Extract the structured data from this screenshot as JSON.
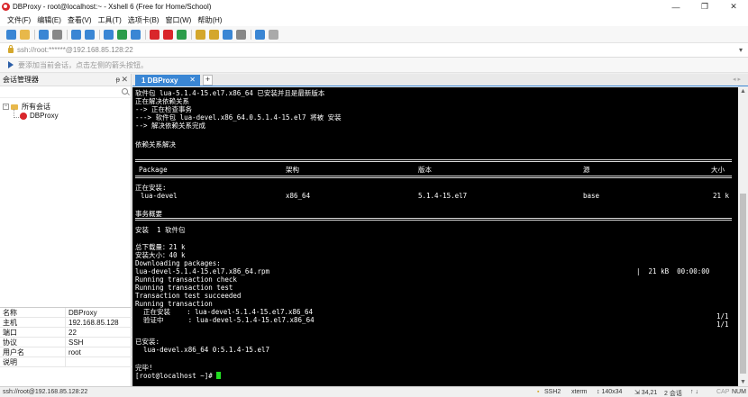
{
  "window": {
    "title": "DBProxy - root@localhost:~ - Xshell 6 (Free for Home/School)",
    "controls": [
      "—",
      "❐",
      "✕"
    ]
  },
  "menu": [
    "文件(F)",
    "编辑(E)",
    "查看(V)",
    "工具(T)",
    "选项卡(B)",
    "窗口(W)",
    "帮助(H)"
  ],
  "toolbar": {
    "icons": [
      "new-session-icon",
      "open-folder-icon",
      "reconnect-icon",
      "disconnect-icon",
      "properties-icon",
      "find-icon",
      "layout-icon",
      "globe-icon",
      "color-scheme-icon",
      "xshell-icon",
      "xftp-icon",
      "fullscreen-icon",
      "lock-icon",
      "keyboard-icon",
      "script-icon",
      "compose-icon",
      "help-icon",
      "chat-icon"
    ],
    "icon_colors": [
      "#3a86d4",
      "#e8b84a",
      "#3a86d4",
      "#888888",
      "#3a86d4",
      "#3a86d4",
      "#3a86d4",
      "#2b9c4a",
      "#3a86d4",
      "#d9262b",
      "#d9262b",
      "#2b9c4a",
      "#d4a72c",
      "#d4a72c",
      "#3a86d4",
      "#888888",
      "#3a86d4",
      "#aaaaaa"
    ]
  },
  "address": {
    "text": "ssh://root:******@192.168.85.128:22"
  },
  "hint": {
    "text": "要添加当前会话，点击左侧的箭头按钮。"
  },
  "sidebar": {
    "title": "会话管理器",
    "pin": "ᵽ",
    "close": "✕",
    "tree": {
      "root_label": "所有会话",
      "child_label": "DBProxy"
    },
    "properties": [
      {
        "key": "名称",
        "value": "DBProxy"
      },
      {
        "key": "主机",
        "value": "192.168.85.128"
      },
      {
        "key": "端口",
        "value": "22"
      },
      {
        "key": "协议",
        "value": "SSH"
      },
      {
        "key": "用户名",
        "value": "root"
      },
      {
        "key": "说明",
        "value": ""
      }
    ]
  },
  "tabs": {
    "active_label": "1 DBProxy",
    "close": "✕",
    "add": "+",
    "nav": "◂ ▸"
  },
  "terminal": {
    "lines_top": [
      "软件包 lua-5.1.4-15.el7.x86_64 已安装并且是最新版本",
      "正在解决依赖关系",
      "--> 正在检查事务",
      "---> 软件包 lua-devel.x86_64.0.5.1.4-15.el7 将被 安装",
      "--> 解决依赖关系完成",
      "",
      "依赖关系解决"
    ],
    "table_headers": [
      "Package",
      "架构",
      "版本",
      "源",
      "大小"
    ],
    "installing_label": "正在安装:",
    "package_row": [
      "lua-devel",
      "x86_64",
      "5.1.4-15.el7",
      "base",
      "21 k"
    ],
    "summary_label": "事务概要",
    "install_count": "安装  1 软件包",
    "lines_bottom": [
      "总下载量：21 k",
      "安装大小：40 k",
      "Downloading packages:",
      "lua-devel-5.1.4-15.el7.x86_64.rpm",
      "Running transaction check",
      "Running transaction test",
      "Transaction test succeeded",
      "Running transaction",
      "  正在安装    : lua-devel-5.1.4-15.el7.x86_64",
      "  验证中      : lua-devel-5.1.4-15.el7.x86_64",
      "",
      "已安装:",
      "  lua-devel.x86_64 0:5.1.4-15.el7",
      "",
      "完毕!",
      "[root@localhost ~]# "
    ],
    "download_progress": "|  21 kB  00:00:00",
    "install_progress": "1/1",
    "verify_progress": "1/1"
  },
  "status": {
    "left": "ssh://root@192.168.85.128:22",
    "protocol": "SSH2",
    "term": "xterm",
    "size": "↕ 140x34",
    "pos": "⇲ 34,21",
    "sessions": "2 会话",
    "nav": "↑ ↓",
    "caps": "CAP",
    "num": "NUM"
  }
}
